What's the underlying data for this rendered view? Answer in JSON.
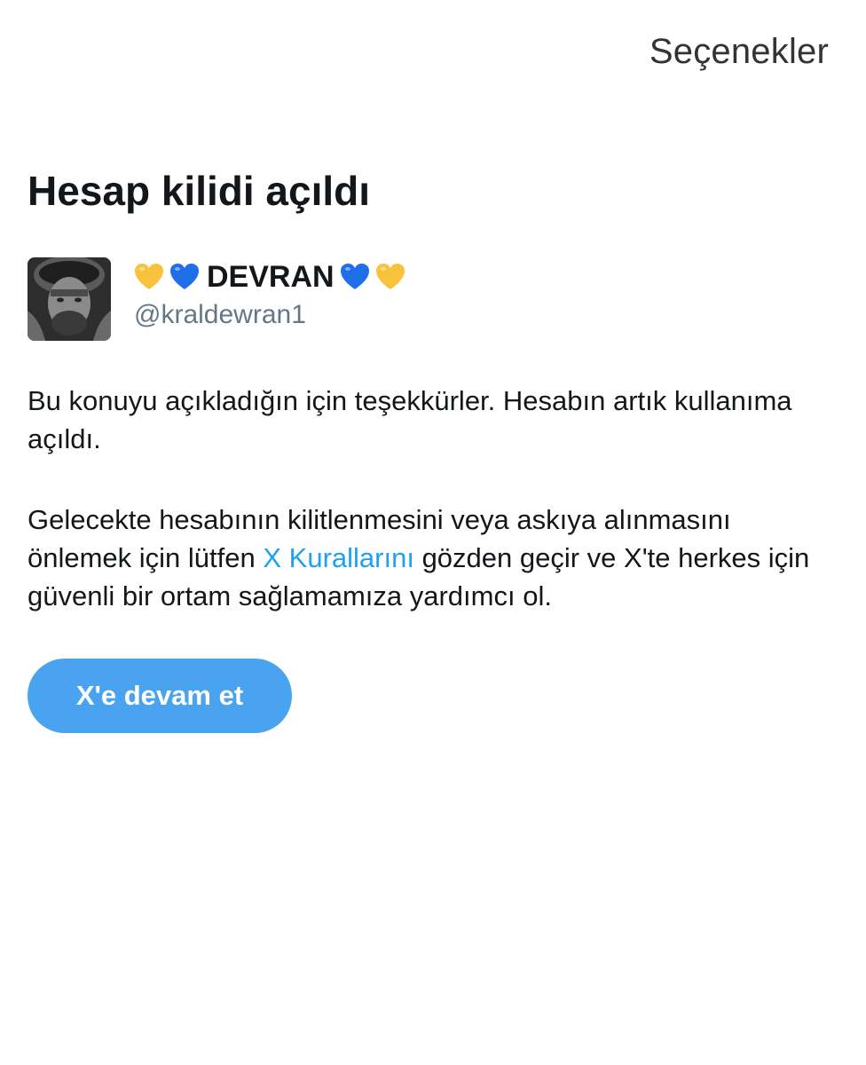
{
  "header": {
    "options_label": "Seçenekler"
  },
  "main": {
    "title": "Hesap kilidi açıldı",
    "profile": {
      "display_name": "DEVRAN",
      "name_decorations": [
        "yellow-heart-icon",
        "blue-heart-icon",
        "blue-heart-icon",
        "yellow-heart-icon"
      ],
      "handle": "@kraldewran1"
    },
    "message_1": "Bu konuyu açıkladığın için teşekkürler. Hesabın artık kullanıma açıldı.",
    "message_2": {
      "before_link": "Gelecekte hesabının kilitlenmesini veya askıya alınmasını önlemek için lütfen ",
      "link_text": "X Kurallarını",
      "after_link": " gözden geçir ve X'te herkes için güvenli bir ortam sağlamamıza yardımcı ol."
    },
    "continue_button_label": "X'e devam et"
  },
  "colors": {
    "button": "#4aa3ef",
    "link": "#1da1f2",
    "handle": "#657786",
    "yellow_heart": "#f9c23c",
    "blue_heart": "#1f6fe8"
  }
}
